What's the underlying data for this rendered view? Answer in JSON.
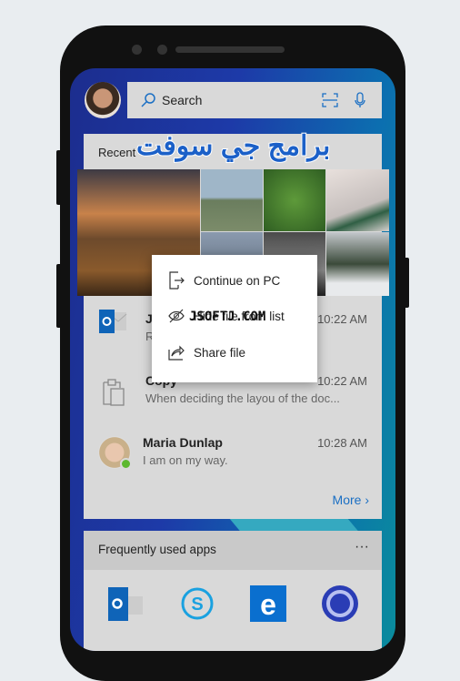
{
  "search": {
    "placeholder": "Search"
  },
  "recent": {
    "title": "Recent",
    "items": [
      {
        "name": "J",
        "subtitle": "R",
        "time": "10:22 AM"
      },
      {
        "name": "Copy",
        "subtitle": "When deciding the layou of the doc...",
        "time": "10:22 AM"
      },
      {
        "name": "Maria Dunlap",
        "subtitle": "I am on my way.",
        "time": "10:28 AM"
      }
    ],
    "more": "More"
  },
  "context_menu": {
    "items": [
      "Continue on PC",
      "Hide file from list",
      "Share file"
    ]
  },
  "apps": {
    "title": "Frequently used apps",
    "more": "···",
    "items": [
      "outlook",
      "skype",
      "edge",
      "cortana"
    ]
  },
  "watermarks": {
    "arabic": "برامج جي سوفت",
    "latin": "JSOFTJ.COM"
  },
  "colors": {
    "accent": "#1a6fc4",
    "card": "#d9d9d9"
  }
}
